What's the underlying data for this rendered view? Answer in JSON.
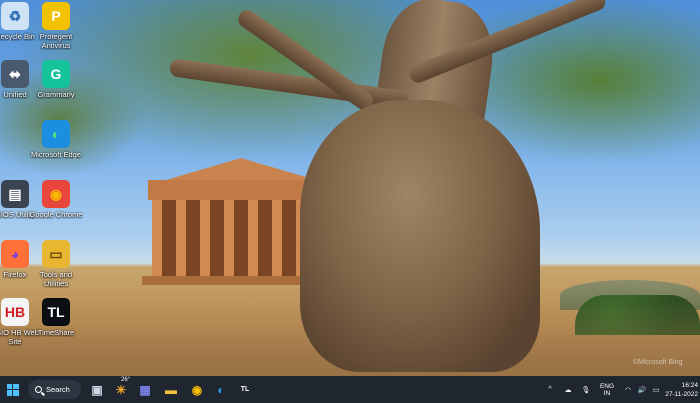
{
  "desktop_icons": [
    {
      "name": "recycle-bin",
      "label": "Recycle Bin",
      "glyph": "♻",
      "bg": "#cfe3f5",
      "color": "#2d6fb7"
    },
    {
      "name": "protegent",
      "label": "Protegent Antivirus",
      "glyph": "P",
      "bg": "#f2c200",
      "color": "#ffffff"
    },
    {
      "name": "unified",
      "label": "Unified",
      "glyph": "⬌",
      "bg": "#4a5a6e",
      "color": "#ffffff"
    },
    {
      "name": "grammarly",
      "label": "Grammarly",
      "glyph": "G",
      "bg": "#15c39a",
      "color": "#ffffff"
    },
    {
      "name": "edge",
      "label": "Microsoft Edge",
      "glyph": "◐",
      "bg": "#1b8ee0",
      "color": "#56e37a"
    },
    {
      "name": "bios-utility",
      "label": "BIOS Utility",
      "glyph": "▤",
      "bg": "#3a4350",
      "color": "#ffffff"
    },
    {
      "name": "chrome",
      "label": "Google Chrome",
      "glyph": "◉",
      "bg": "#e8453c",
      "color": "#fbbc04"
    },
    {
      "name": "firefox",
      "label": "Firefox",
      "glyph": "◕",
      "bg": "#ff7139",
      "color": "#7b3fe4"
    },
    {
      "name": "tools",
      "label": "Tools and Utilities",
      "glyph": "▭",
      "bg": "#e8b632",
      "color": "#6b4a00"
    },
    {
      "name": "asio-hb",
      "label": "ASIO HB Web Site",
      "glyph": "HB",
      "bg": "#f4f4f4",
      "color": "#d11e26"
    },
    {
      "name": "timelapse",
      "label": "TimeShare",
      "glyph": "TL",
      "bg": "#0b0f14",
      "color": "#ffffff"
    }
  ],
  "taskbar": {
    "search_label": "Search",
    "weather_temp": "26°",
    "apps": [
      {
        "name": "task-view",
        "glyph": "▣",
        "color": "#cfd7e2"
      },
      {
        "name": "weather",
        "glyph": "☀",
        "color": "#f6a623"
      },
      {
        "name": "teams",
        "glyph": "▦",
        "color": "#7b83eb"
      },
      {
        "name": "file-explorer",
        "glyph": "▬",
        "color": "#f3c33d"
      },
      {
        "name": "chrome-taskbar",
        "glyph": "◉",
        "color": "#fbbc04"
      },
      {
        "name": "edge-taskbar",
        "glyph": "◐",
        "color": "#27a1e8"
      },
      {
        "name": "timelapse-taskbar",
        "glyph": "TL",
        "color": "#ffffff"
      }
    ],
    "tray": {
      "chevron": "^",
      "lang_top": "ENG",
      "lang_bottom": "IN",
      "time": "16:24",
      "date": "27-11-2022"
    }
  },
  "watermark": "©Microsoft Bing"
}
